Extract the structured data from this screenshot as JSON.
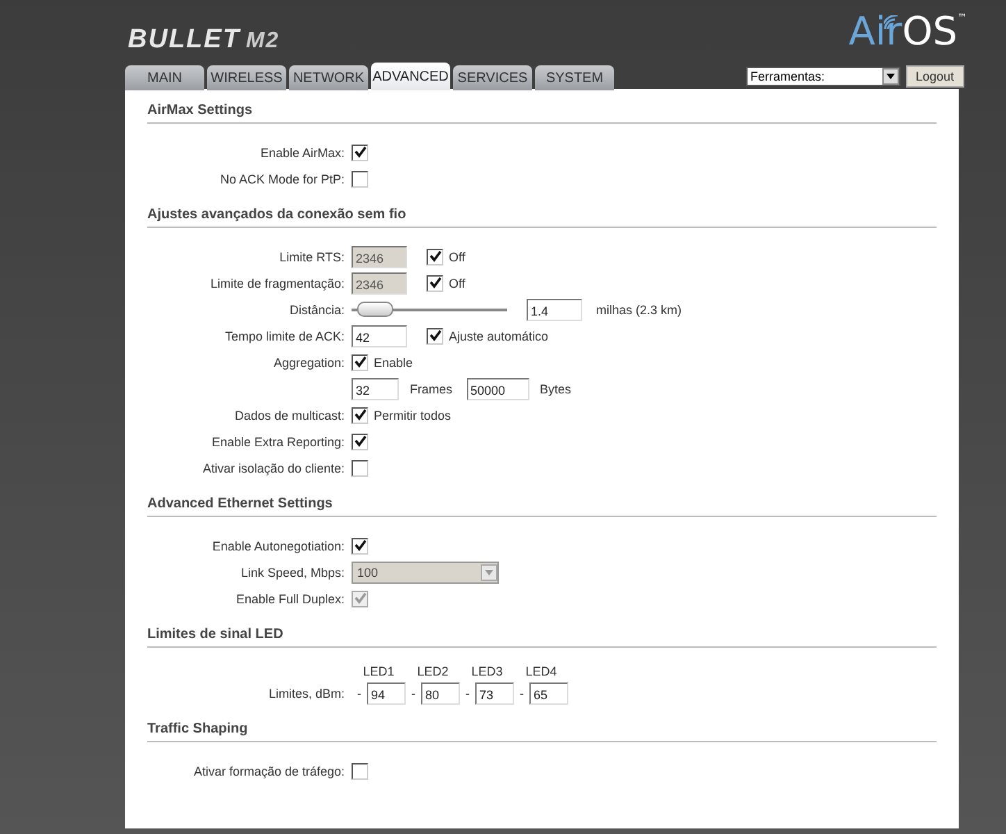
{
  "logo": {
    "product": "BULLET",
    "model": "M2"
  },
  "brand": {
    "prefix": "Air",
    "suffix": "OS",
    "mark": "™"
  },
  "tabs": [
    {
      "label": "MAIN",
      "selected": false
    },
    {
      "label": "WIRELESS",
      "selected": false
    },
    {
      "label": "NETWORK",
      "selected": false
    },
    {
      "label": "ADVANCED",
      "selected": true
    },
    {
      "label": "SERVICES",
      "selected": false
    },
    {
      "label": "SYSTEM",
      "selected": false
    }
  ],
  "tools": {
    "value": "Ferramentas:",
    "button": "Logout"
  },
  "sections": [
    {
      "title": "AirMax Settings",
      "rows": [
        {
          "kind": "check",
          "label": "Enable AirMax:",
          "checked": true,
          "disabled": false
        },
        {
          "kind": "check",
          "label": "No ACK Mode for PtP:",
          "checked": false,
          "disabled": false
        }
      ]
    },
    {
      "title": "Ajustes avançados da conexão sem fio",
      "rows": [
        {
          "kind": "fieldcheck",
          "label": "Limite RTS:",
          "value": "2346",
          "disabled": true,
          "checked": true,
          "check_label": "Off"
        },
        {
          "kind": "fieldcheck",
          "label": "Limite de fragmentação:",
          "value": "2346",
          "disabled": true,
          "checked": true,
          "check_label": "Off"
        },
        {
          "kind": "slider",
          "label": "Distância:",
          "level": 0.05,
          "value": "1.4",
          "unit": "milhas (2.3 km)"
        },
        {
          "kind": "fieldcheck",
          "label": "Tempo limite de ACK:",
          "value": "42",
          "disabled": false,
          "checked": true,
          "check_label": "Ajuste automático"
        },
        {
          "kind": "check",
          "label": "Aggregation:",
          "checked": true,
          "disabled": false,
          "check_label": "Enable"
        },
        {
          "kind": "fields",
          "fields": [
            {
              "value": "32",
              "unit": "Frames"
            },
            {
              "value": "50000",
              "unit": "Bytes"
            }
          ]
        },
        {
          "kind": "check",
          "label": "Dados de multicast:",
          "checked": true,
          "disabled": false,
          "check_label": "Permitir todos"
        },
        {
          "kind": "check",
          "label": "Enable Extra Reporting:",
          "checked": true,
          "disabled": false
        },
        {
          "kind": "check",
          "label": "Ativar isolação do cliente:",
          "checked": false,
          "disabled": false
        }
      ]
    },
    {
      "title": "Advanced Ethernet Settings",
      "rows": [
        {
          "kind": "check",
          "label": "Enable Autonegotiation:",
          "checked": true,
          "disabled": false
        },
        {
          "kind": "select",
          "label": "Link Speed, Mbps:",
          "value": "100",
          "disabled": true
        },
        {
          "kind": "check",
          "label": "Enable Full Duplex:",
          "checked": true,
          "disabled": true
        }
      ]
    },
    {
      "title": "Limites de sinal LED",
      "rows": [
        {
          "kind": "leds",
          "label": "Limites, dBm:",
          "leds": [
            {
              "name": "LED1",
              "sign": "-",
              "value": "94"
            },
            {
              "name": "LED2",
              "sign": "-",
              "value": "80"
            },
            {
              "name": "LED3",
              "sign": "-",
              "value": "73"
            },
            {
              "name": "LED4",
              "sign": "-",
              "value": "65"
            }
          ]
        }
      ]
    },
    {
      "title": "Traffic Shaping",
      "rows": [
        {
          "kind": "check",
          "label": "Ativar formação de tráfego:",
          "checked": false,
          "disabled": false
        }
      ]
    }
  ]
}
